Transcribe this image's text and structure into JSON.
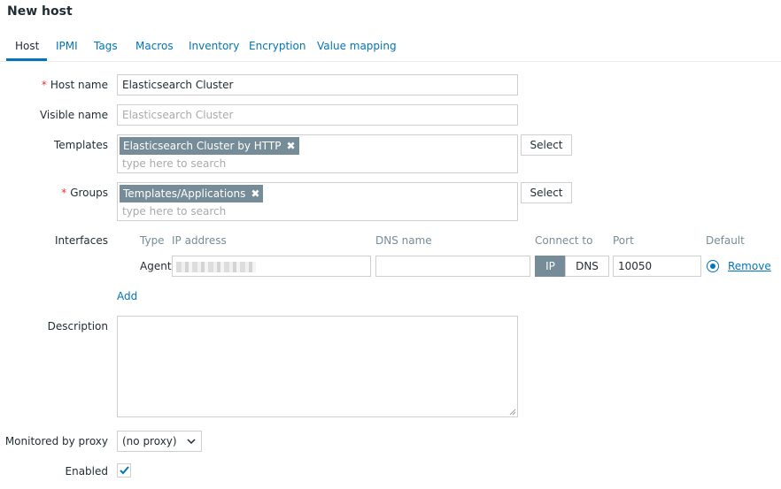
{
  "page": {
    "title": "New host"
  },
  "tabs": [
    {
      "label": "Host"
    },
    {
      "label": "IPMI"
    },
    {
      "label": "Tags"
    },
    {
      "label": "Macros"
    },
    {
      "label": "Inventory"
    },
    {
      "label": "Encryption"
    },
    {
      "label": "Value mapping"
    }
  ],
  "form": {
    "host_name": {
      "label": "Host name",
      "required_mark": "*",
      "value": "Elasticsearch Cluster"
    },
    "visible_name": {
      "label": "Visible name",
      "placeholder": "Elasticsearch Cluster"
    },
    "templates": {
      "label": "Templates",
      "chip": "Elasticsearch Cluster by HTTP",
      "placeholder": "type here to search",
      "select_label": "Select"
    },
    "groups": {
      "label": "Groups",
      "required_mark": "*",
      "chip": "Templates/Applications",
      "placeholder": "type here to search",
      "select_label": "Select"
    },
    "interfaces": {
      "label": "Interfaces",
      "columns": {
        "type": "Type",
        "ip": "IP address",
        "dns": "DNS name",
        "connect": "Connect to",
        "port": "Port",
        "default": "Default"
      },
      "row": {
        "type": "Agent",
        "ip": "",
        "dns": "",
        "connect_ip": "IP",
        "connect_dns": "DNS",
        "port": "10050",
        "remove": "Remove"
      },
      "add_label": "Add"
    },
    "description": {
      "label": "Description",
      "value": ""
    },
    "proxy": {
      "label": "Monitored by proxy",
      "value": "(no proxy)"
    },
    "enabled": {
      "label": "Enabled",
      "checked": true
    }
  },
  "colors": {
    "accent": "#0275b8",
    "chip": "#768d99",
    "required": "#e33734",
    "border": "#cfcfcf"
  }
}
